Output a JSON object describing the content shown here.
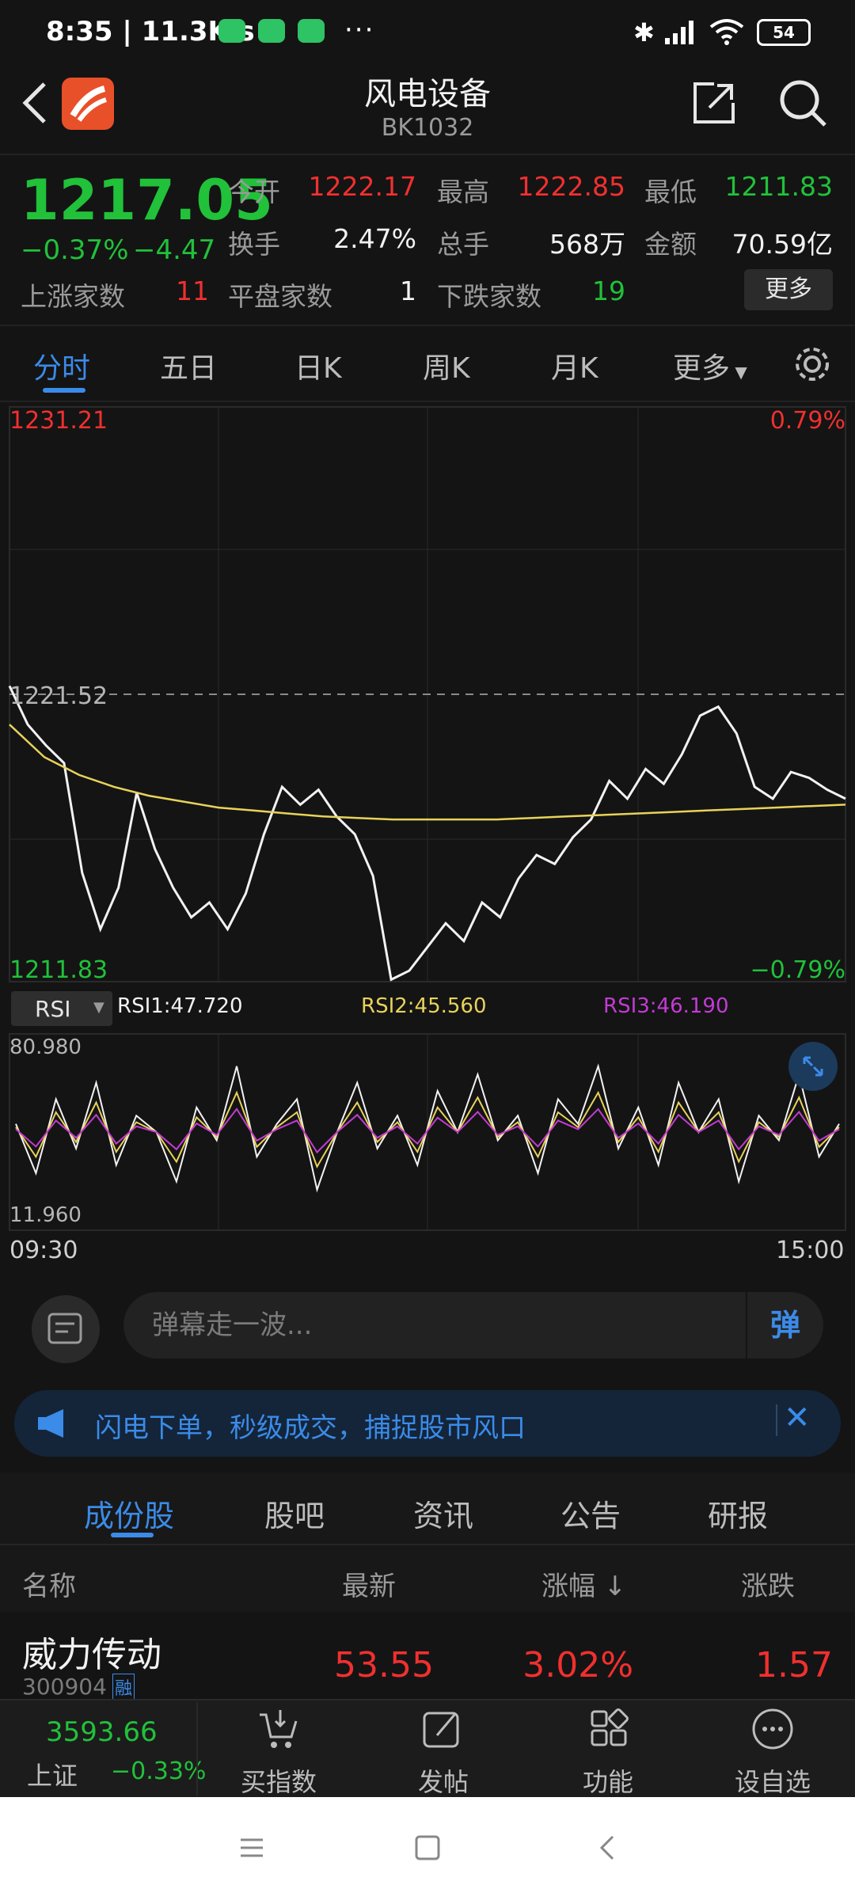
{
  "status_bar": {
    "time": "8:35 | 11.3K/s",
    "dots": "···",
    "battery": "54"
  },
  "header": {
    "title": "风电设备",
    "code": "BK1032"
  },
  "quote": {
    "price": "1217.05",
    "change_pct": "−0.37%",
    "change_abs": "−4.47",
    "open_label": "今开",
    "open": "1222.17",
    "high_label": "最高",
    "high": "1222.85",
    "low_label": "最低",
    "low": "1211.83",
    "turnover_label": "换手",
    "turnover": "2.47%",
    "volume_label": "总手",
    "volume": "568万",
    "amount_label": "金额",
    "amount": "70.59亿",
    "up_label": "上涨家数",
    "up_count": "11",
    "flat_label": "平盘家数",
    "flat_count": "1",
    "down_label": "下跌家数",
    "down_count": "19",
    "more_label": "更多"
  },
  "tabs": [
    "分时",
    "五日",
    "日K",
    "周K",
    "月K",
    "更多"
  ],
  "chart_labels": {
    "price_max": "1231.21",
    "price_mid": "1221.52",
    "price_min": "1211.83",
    "pct_max": "0.79%",
    "pct_min": "−0.79%",
    "rsi_select": "RSI",
    "rsi1": "RSI1:47.720",
    "rsi2": "RSI2:45.560",
    "rsi3": "RSI3:46.190",
    "rsi_max": "80.980",
    "rsi_min": "11.960",
    "time_start": "09:30",
    "time_end": "15:00"
  },
  "chart_data": {
    "type": "line",
    "x_range": [
      "09:30",
      "15:00"
    ],
    "ylim": [
      1211.83,
      1231.21
    ],
    "prev_close": 1221.52,
    "series": [
      {
        "values": [
          1221.8,
          1220.5,
          1219.8,
          1219.2,
          1215.5,
          1213.6,
          1215.0,
          1218.2,
          1216.3,
          1215.0,
          1214.0,
          1214.5,
          1213.6,
          1214.8,
          1216.8,
          1218.4,
          1217.8,
          1218.3,
          1217.4,
          1216.8,
          1215.4,
          1211.9,
          1212.2,
          1213.0,
          1213.8,
          1213.2,
          1214.5,
          1214.0,
          1215.3,
          1216.1,
          1215.8,
          1216.7,
          1217.3,
          1218.6,
          1218.0,
          1219.0,
          1218.5,
          1219.5,
          1220.8,
          1221.1,
          1220.2,
          1218.4,
          1218.0,
          1218.9,
          1218.7,
          1218.3,
          1218.0
        ]
      },
      {
        "values": [
          1220.5,
          1219.4,
          1218.8,
          1218.4,
          1218.1,
          1217.9,
          1217.7,
          1217.6,
          1217.5,
          1217.4,
          1217.35,
          1217.3,
          1217.3,
          1217.3,
          1217.3,
          1217.35,
          1217.4,
          1217.45,
          1217.5,
          1217.55,
          1217.6,
          1217.65,
          1217.7,
          1217.75,
          1217.8
        ]
      }
    ]
  },
  "danmu": {
    "placeholder": "弹幕走一波...",
    "button": "弹"
  },
  "banner": {
    "text": "闪电下单，秒级成交，捕捉股市风口"
  },
  "section_tabs": [
    "成份股",
    "股吧",
    "资讯",
    "公告",
    "研报"
  ],
  "table": {
    "headers": [
      "名称",
      "最新",
      "涨幅 ↓",
      "涨跌"
    ],
    "rows": [
      {
        "name": "威力传动",
        "code": "300904",
        "tag": "融",
        "price": "53.55",
        "pct": "3.02%",
        "change": "1.57"
      }
    ]
  },
  "bottom_bar": {
    "index_value": "3593.66",
    "index_name": "上证",
    "index_pct": "−0.33%",
    "items": [
      "买指数",
      "发帖",
      "功能",
      "设自选"
    ]
  },
  "colors": {
    "up": "#f0302f",
    "down": "#21c13a",
    "accent": "#3b8be8",
    "avg_line": "#e8d25a",
    "rsi3": "#c23bd4"
  }
}
